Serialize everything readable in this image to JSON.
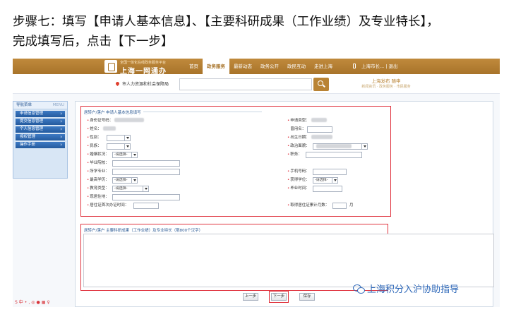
{
  "instruction": {
    "line1": "步骤七：填写【申请人基本信息】、【主要科研成果（工作业绩）及专业特长】，",
    "line2": "完成填写后，点击【下一步】"
  },
  "header": {
    "brand_sub": "全国一体化在线政务服务平台",
    "brand": "上海一网通办",
    "nav": [
      "首页",
      "政务服务",
      "最新动态",
      "政务公开",
      "政民互动",
      "走进上海"
    ],
    "user": "上海市长...",
    "logout": "退出"
  },
  "search": {
    "department": "市人力资源和社会保障局",
    "value": "",
    "promo_title": "上海发布 随申",
    "promo_sub": "新闻资讯 · 政务服务 · 市民服务"
  },
  "sidebar": {
    "title": "导航菜单",
    "title_hint": "MENU",
    "items": [
      "申请信息管理",
      "提交信息管理",
      "个人信息管理",
      "授权管理",
      "操作手册"
    ],
    "bottom": "S中•,◎●▦♀"
  },
  "form": {
    "section1_title": "居转户/落户 申请人基本信息填写",
    "fields": {
      "id_number": "身份证号码：",
      "apply_type": "申请类型：",
      "name": "姓名：",
      "alias": "曾用名：",
      "gender": "性别：",
      "birth_date": "出生日期：",
      "ethnicity": "民族：",
      "political": "政治面貌：",
      "marital": "婚姻状况：",
      "marital_value": "-请选择-",
      "duty": "职务：",
      "graduate_school": "毕业院校：",
      "major": "所学专业：",
      "phone": "手机号码：",
      "education": "最高学历：",
      "education_value": "-请选择-",
      "degree": "获得学位：",
      "degree_value": "-请选择-",
      "edu_type": "教育类型：",
      "edu_type_value": "-请选择-",
      "grad_time": "毕业时间：",
      "address": "现居住地：",
      "residence_time": "居住证首次办证时间：",
      "residence_months": "取得居住证累计月数：",
      "month_unit": "月"
    },
    "section2_title": "居转户/落户 主要科研成果（工作业绩）及专业特长（限800个汉字）",
    "textarea_value": ""
  },
  "buttons": {
    "prev": "上一步",
    "next": "下一步",
    "save": "保存"
  },
  "watermark": "上海积分入沪协助指导",
  "colors": {
    "banner": "#a8742a",
    "highlight": "#e0343f",
    "sidebar_item": "#245a9e"
  }
}
